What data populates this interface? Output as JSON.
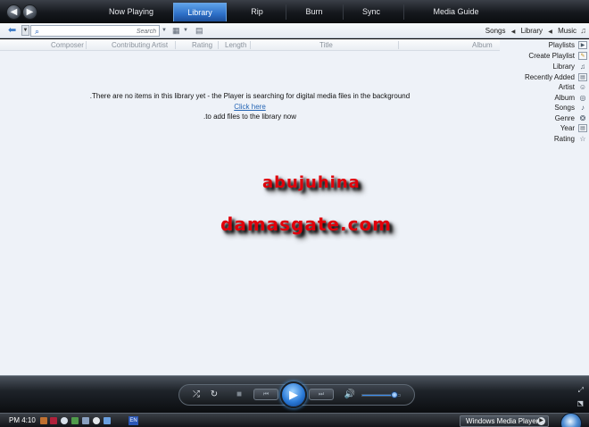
{
  "topbar": {
    "back_glyph": "◀",
    "forward_glyph": "▶",
    "tabs": [
      {
        "label": "Now Playing",
        "active": false
      },
      {
        "label": "Library",
        "active": true
      },
      {
        "label": "Rip",
        "active": false
      },
      {
        "label": "Burn",
        "active": false
      },
      {
        "label": "Sync",
        "active": false
      },
      {
        "label": "Media Guide",
        "active": false
      }
    ]
  },
  "addressbar": {
    "search_placeholder": "Search",
    "breadcrumb": [
      "Songs",
      "Library",
      "Music"
    ],
    "breadcrumb_separator": "◀"
  },
  "columns": [
    "Composer",
    "Contributing Artist",
    "Rating",
    "Length",
    "Title",
    "Album"
  ],
  "message": {
    "line1": ".There are no items in this library yet - the Player is searching for digital media files in the background",
    "link": "Click here",
    "line3": ".to add files to the library now"
  },
  "navpanel": {
    "items": [
      {
        "label": "Playlists",
        "icon": "play-arrow-icon"
      },
      {
        "label": "Create Playlist",
        "icon": "new-playlist-icon"
      },
      {
        "label": "Library",
        "icon": "music-note-icon"
      },
      {
        "label": "Recently Added",
        "icon": "calendar-icon"
      },
      {
        "label": "Artist",
        "icon": "artist-icon"
      },
      {
        "label": "Album",
        "icon": "album-disc-icon"
      },
      {
        "label": "Songs",
        "icon": "music-note-icon"
      },
      {
        "label": "Genre",
        "icon": "genre-icon"
      },
      {
        "label": "Year",
        "icon": "calendar-icon"
      },
      {
        "label": "Rating",
        "icon": "star-icon"
      }
    ]
  },
  "watermark": {
    "line1": "abujuhina",
    "line2": "damasgate.com",
    "color": "#e0000a"
  },
  "player": {
    "volume_level": 0.85,
    "accent": "#3c8ef0"
  },
  "taskbar": {
    "clock": "PM 4:10",
    "language": "EN",
    "task_label": "Windows Media Player"
  }
}
